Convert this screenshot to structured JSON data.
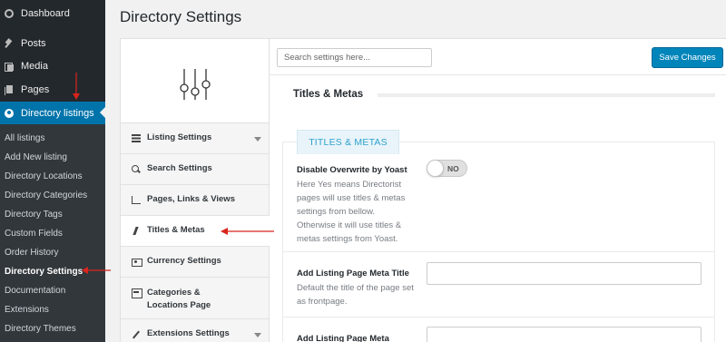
{
  "wp_menu": {
    "items": [
      {
        "label": "Dashboard",
        "icon": "dashboard-icon"
      },
      {
        "label": "Posts",
        "icon": "pushpin-icon"
      },
      {
        "label": "Media",
        "icon": "media-icon"
      },
      {
        "label": "Pages",
        "icon": "pages-icon"
      },
      {
        "label": "Directory listings",
        "icon": "directory-icon"
      }
    ],
    "submenu": [
      "All listings",
      "Add New listing",
      "Directory Locations",
      "Directory Categories",
      "Directory Tags",
      "Custom Fields",
      "Order History",
      "Directory Settings",
      "Documentation",
      "Extensions",
      "Directory Themes"
    ],
    "current_submenu": "Directory Settings"
  },
  "page": {
    "title": "Directory Settings"
  },
  "settings_nav": {
    "logo_icon": "sliders-icon",
    "items": [
      {
        "label": "Listing Settings",
        "icon": "list-icon",
        "has_caret": true
      },
      {
        "label": "Search Settings",
        "icon": "search-icon",
        "has_caret": false
      },
      {
        "label": "Pages, Links & Views",
        "icon": "chart-icon",
        "has_caret": false
      },
      {
        "label": "Titles & Metas",
        "icon": "bolt-icon",
        "has_caret": false,
        "active": true
      },
      {
        "label": "Currency Settings",
        "icon": "money-icon",
        "has_caret": false
      },
      {
        "label": "Categories & Locations Page",
        "icon": "card-icon",
        "has_caret": false
      },
      {
        "label": "Extensions Settings",
        "icon": "extension-icon",
        "has_caret": true
      }
    ]
  },
  "toolbar": {
    "search_placeholder": "Search settings here...",
    "save_label": "Save Changes"
  },
  "section": {
    "title": "Titles & Metas",
    "tab_label": "TITLES & METAS"
  },
  "fields": {
    "disable_overwrite": {
      "label": "Disable Overwrite by Yoast",
      "description": "Here Yes means Directorist pages will use titles & metas settings from bellow. Otherwise it will use titles & metas settings from Yoast.",
      "toggle_value": "NO"
    },
    "meta_title": {
      "label": "Add Listing Page Meta Title",
      "description": "Default the title of the page set as frontpage."
    },
    "meta_desc": {
      "label": "Add Listing Page Meta"
    }
  },
  "colors": {
    "sidebar_bg": "#23282d",
    "active_blue": "#0073aa",
    "accent": "#2ea2cc",
    "annotation_red": "#d9241c"
  }
}
